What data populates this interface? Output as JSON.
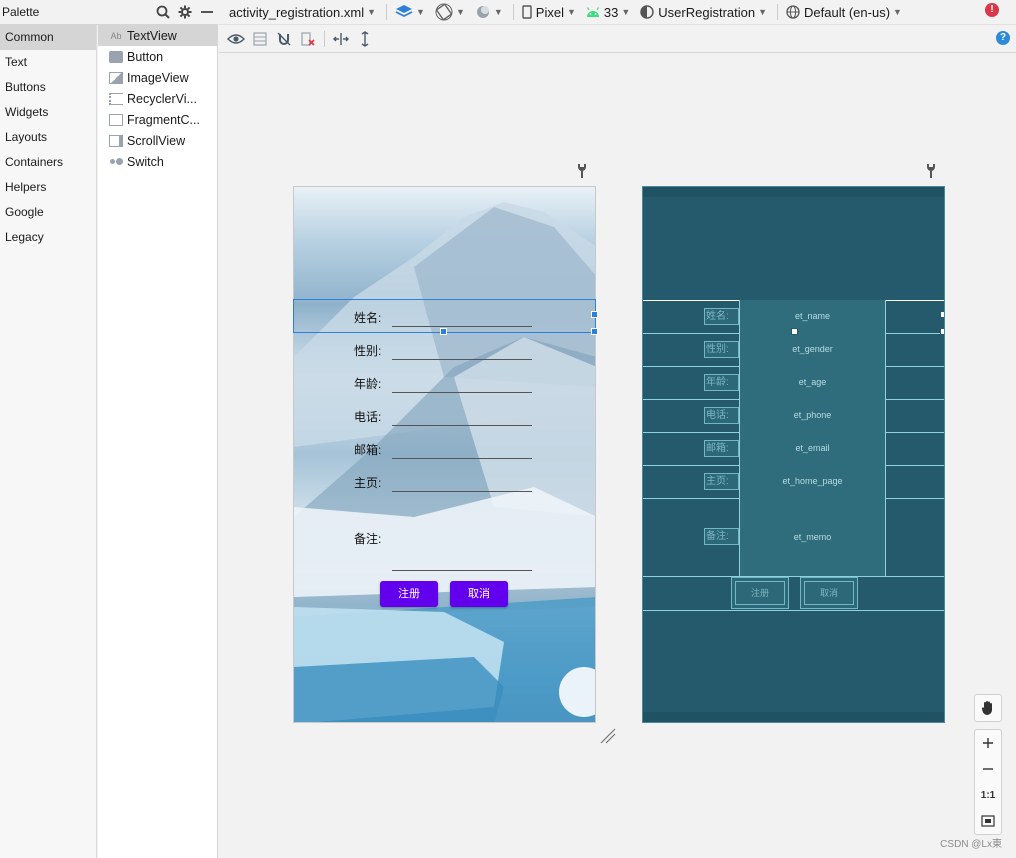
{
  "palette": {
    "title": "Palette",
    "categories": [
      "Common",
      "Text",
      "Buttons",
      "Widgets",
      "Layouts",
      "Containers",
      "Helpers",
      "Google",
      "Legacy"
    ],
    "items": [
      {
        "label": "TextView",
        "icon": "textview-icon"
      },
      {
        "label": "Button",
        "icon": "button-icon"
      },
      {
        "label": "ImageView",
        "icon": "imageview-icon"
      },
      {
        "label": "RecyclerVi...",
        "icon": "recyclerview-icon"
      },
      {
        "label": "FragmentC...",
        "icon": "fragment-icon"
      },
      {
        "label": "ScrollView",
        "icon": "scrollview-icon"
      },
      {
        "label": "Switch",
        "icon": "switch-icon"
      }
    ],
    "textview_glyph": "Ab"
  },
  "toolbar": {
    "file": "activity_registration.xml",
    "device": "Pixel",
    "api": "33",
    "theme": "UserRegistration",
    "locale": "Default (en-us)",
    "error_glyph": "!",
    "help_glyph": "?"
  },
  "design": {
    "labels": [
      "姓名:",
      "性别:",
      "年龄:",
      "电话:",
      "邮箱:",
      "主页:",
      "备注:"
    ],
    "register_button": "注册",
    "cancel_button": "取消"
  },
  "blueprint": {
    "labels": [
      "姓名:",
      "性别:",
      "年龄:",
      "电话:",
      "邮箱:",
      "主页:",
      "备注:"
    ],
    "fields": [
      "et_name",
      "et_gender",
      "et_age",
      "et_phone",
      "et_email",
      "et_home_page",
      "et_memo"
    ],
    "register_button": "注册",
    "cancel_button": "取消"
  },
  "zoom": {
    "one_to_one": "1:1"
  },
  "watermark": "CSDN @Lx東",
  "colors": {
    "accent": "#6200ee",
    "blueprint_bg": "#245a6c",
    "selection": "#2f7fd8"
  }
}
